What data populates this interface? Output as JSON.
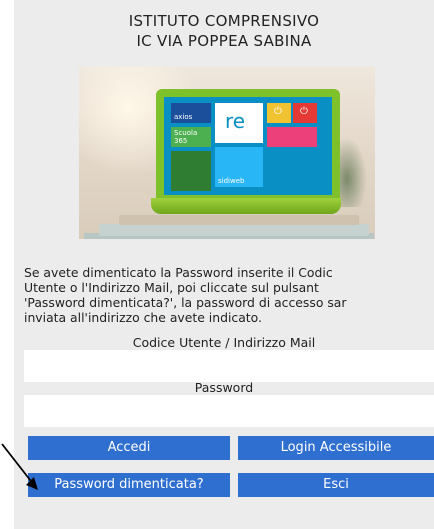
{
  "header": {
    "line1": "ISTITUTO COMPRENSIVO",
    "line2": "IC VIA POPPEA SABINA"
  },
  "hero": {
    "tiles": {
      "axios": "axios",
      "re": "re",
      "scuola": "Scuola 365",
      "sidiweb": "sidiweb",
      "icon_power": "⏻"
    }
  },
  "instructions": {
    "line1": "Se avete dimenticato la Password inserite il Codic",
    "line2": "Utente o l'Indirizzo Mail, poi cliccate sul pulsant",
    "line3": "'Password dimenticata?', la password di accesso sar",
    "line4": "inviata all'indirizzo che avete indicato."
  },
  "form": {
    "user_label": "Codice Utente / Indirizzo Mail",
    "user_value": "",
    "password_label": "Password",
    "password_value": ""
  },
  "buttons": {
    "accedi": "Accedi",
    "login_accessibile": "Login Accessibile",
    "password_dimenticata": "Password dimenticata?",
    "esci": "Esci"
  },
  "colors": {
    "button": "#2f6fcf",
    "panel": "#ececec"
  }
}
